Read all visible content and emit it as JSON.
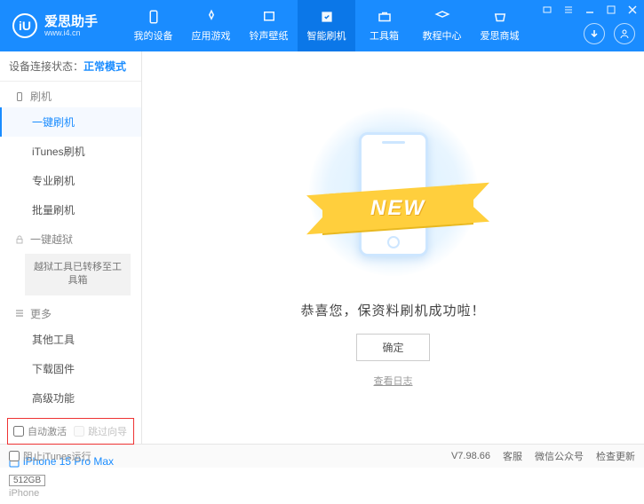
{
  "header": {
    "logo_char": "iU",
    "app_name": "爱思助手",
    "url": "www.i4.cn",
    "nav": [
      {
        "label": "我的设备"
      },
      {
        "label": "应用游戏"
      },
      {
        "label": "铃声壁纸"
      },
      {
        "label": "智能刷机"
      },
      {
        "label": "工具箱"
      },
      {
        "label": "教程中心"
      },
      {
        "label": "爱思商城"
      }
    ]
  },
  "sidebar": {
    "status_prefix": "设备连接状态：",
    "status_mode": "正常模式",
    "section_flash": "刷机",
    "items_flash": [
      {
        "label": "一键刷机",
        "active": true
      },
      {
        "label": "iTunes刷机"
      },
      {
        "label": "专业刷机"
      },
      {
        "label": "批量刷机"
      }
    ],
    "section_jailbreak": "一键越狱",
    "jailbreak_notice": "越狱工具已转移至工具箱",
    "section_more": "更多",
    "items_more": [
      {
        "label": "其他工具"
      },
      {
        "label": "下载固件"
      },
      {
        "label": "高级功能"
      }
    ],
    "chk_auto_activate": "自动激活",
    "chk_skip_guide": "跳过向导",
    "device_name": "iPhone 15 Pro Max",
    "device_storage": "512GB",
    "device_type": "iPhone"
  },
  "main": {
    "ribbon": "NEW",
    "success_text": "恭喜您，保资料刷机成功啦！",
    "ok_button": "确定",
    "view_log": "查看日志"
  },
  "footer": {
    "block_itunes": "阻止iTunes运行",
    "version": "V7.98.66",
    "links": [
      "客服",
      "微信公众号",
      "检查更新"
    ]
  }
}
